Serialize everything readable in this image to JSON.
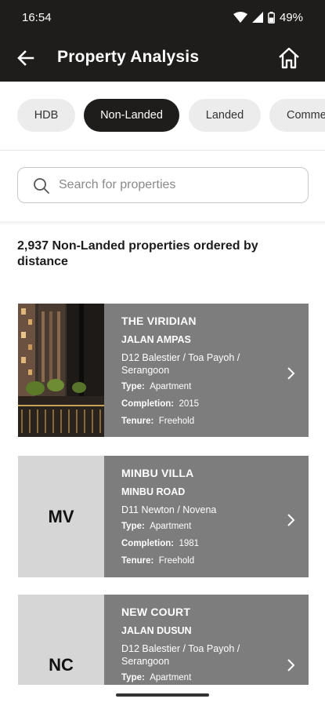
{
  "status": {
    "time": "16:54",
    "battery": "49%"
  },
  "header": {
    "title": "Property Analysis"
  },
  "filters": {
    "chips": [
      {
        "label": "HDB",
        "active": false
      },
      {
        "label": "Non-Landed",
        "active": true
      },
      {
        "label": "Landed",
        "active": false
      },
      {
        "label": "Comme",
        "active": false
      }
    ]
  },
  "search": {
    "placeholder": "Search for properties",
    "value": ""
  },
  "results": {
    "summary": "2,937 Non-Landed properties ordered by distance",
    "type_label": "Type:",
    "completion_label": "Completion:",
    "tenure_label": "Tenure:",
    "items": [
      {
        "name": "THE VIRIDIAN",
        "street": "JALAN AMPAS",
        "district": "D12 Balestier / Toa Payoh / Serangoon",
        "type": "Apartment",
        "completion": "2015",
        "tenure": "Freehold",
        "initials": ""
      },
      {
        "name": "MINBU VILLA",
        "street": "MINBU ROAD",
        "district": "D11 Newton / Novena",
        "type": "Apartment",
        "completion": "1981",
        "tenure": "Freehold",
        "initials": "MV"
      },
      {
        "name": "NEW COURT",
        "street": "JALAN DUSUN",
        "district": "D12 Balestier / Toa Payoh / Serangoon",
        "type": "Apartment",
        "initials": "NC"
      }
    ]
  },
  "colors": {
    "bar": "#1f1d1b",
    "card": "#7d7d7d",
    "thumb": "#d6d6d6",
    "chip": "#ececec"
  },
  "icons": {
    "back": "arrow-left-icon",
    "home": "home-icon",
    "search": "search-icon",
    "chevron": "chevron-right-icon"
  }
}
